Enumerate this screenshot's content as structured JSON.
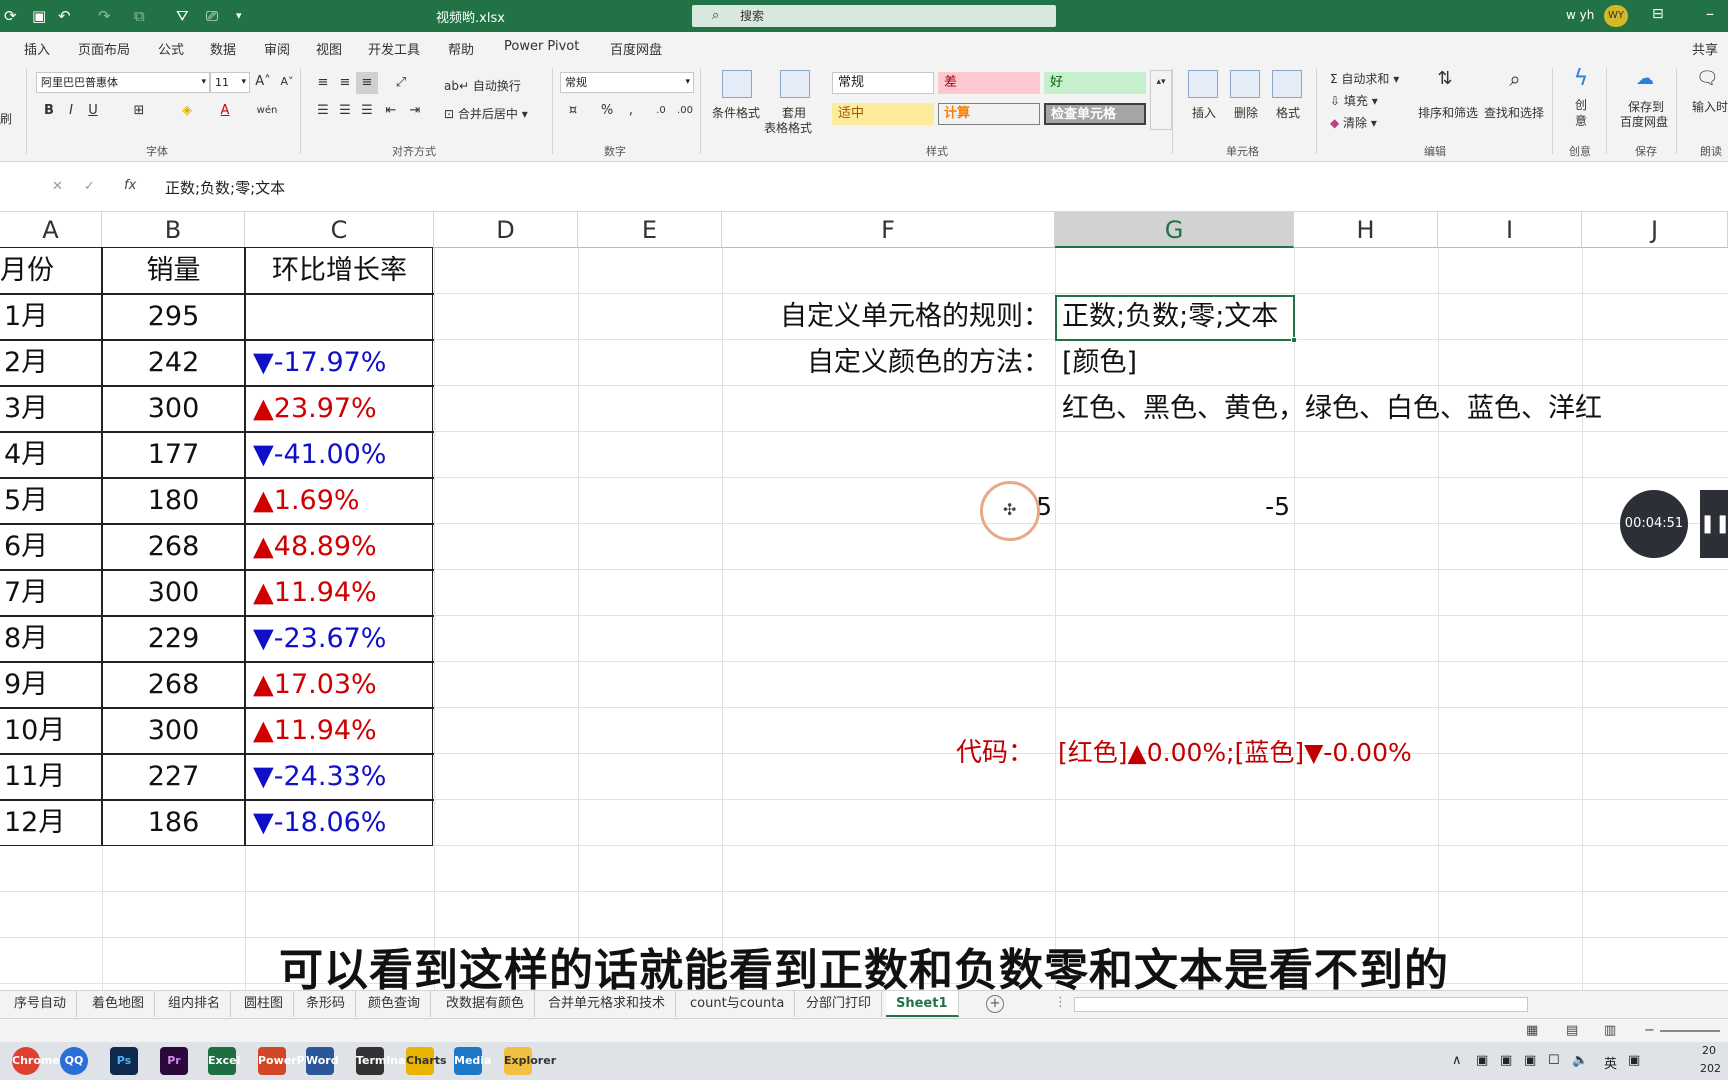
{
  "titlebar": {
    "filename": "视频哟.xlsx",
    "search_placeholder": "搜索",
    "user": "w yh",
    "avatar": "WY"
  },
  "menu": [
    "插入",
    "页面布局",
    "公式",
    "数据",
    "审阅",
    "视图",
    "开发工具",
    "帮助",
    "Power Pivot",
    "百度网盘"
  ],
  "share_label": "共享",
  "ribbon": {
    "font_name": "阿里巴巴普惠体",
    "font_size": "11",
    "wrap_text": "自动换行",
    "merge_center": "合并后居中",
    "number_format": "常规",
    "cond_format": "条件格式",
    "table_format_1": "套用",
    "table_format_2": "表格格式",
    "styles": {
      "normal": "常规",
      "bad": "差",
      "good": "好",
      "neutral": "适中",
      "calc": "计算",
      "check": "检查单元格"
    },
    "insert": "插入",
    "delete": "删除",
    "format": "格式",
    "autosum": "自动求和",
    "fill": "填充",
    "clear": "清除",
    "sort_filter": "排序和筛选",
    "find_select": "查找和选择",
    "creative_1": "创",
    "creative_2": "意",
    "save_baidu_1": "保存到",
    "save_baidu_2": "百度网盘",
    "input_label": "输入时",
    "groups": {
      "clipboard": "刷",
      "font": "字体",
      "alignment": "对齐方式",
      "number": "数字",
      "styles": "样式",
      "cells": "单元格",
      "editing": "编辑",
      "creative": "创意",
      "save": "保存",
      "read": "朗读"
    }
  },
  "formula_bar": {
    "value": "正数;负数;零;文本"
  },
  "columns": [
    "A",
    "B",
    "C",
    "D",
    "E",
    "F",
    "G",
    "H",
    "I",
    "J"
  ],
  "table": {
    "headers": [
      "月份",
      "销量",
      "环比增长率"
    ],
    "rows": [
      {
        "month": "1月",
        "sales": "295",
        "rate": "",
        "dir": ""
      },
      {
        "month": "2月",
        "sales": "242",
        "rate": "▼-17.97%",
        "dir": "down"
      },
      {
        "month": "3月",
        "sales": "300",
        "rate": "▲23.97%",
        "dir": "up"
      },
      {
        "month": "4月",
        "sales": "177",
        "rate": "▼-41.00%",
        "dir": "down"
      },
      {
        "month": "5月",
        "sales": "180",
        "rate": "▲1.69%",
        "dir": "up"
      },
      {
        "month": "6月",
        "sales": "268",
        "rate": "▲48.89%",
        "dir": "up"
      },
      {
        "month": "7月",
        "sales": "300",
        "rate": "▲11.94%",
        "dir": "up"
      },
      {
        "month": "8月",
        "sales": "229",
        "rate": "▼-23.67%",
        "dir": "down"
      },
      {
        "month": "9月",
        "sales": "268",
        "rate": "▲17.03%",
        "dir": "up"
      },
      {
        "month": "10月",
        "sales": "300",
        "rate": "▲11.94%",
        "dir": "up"
      },
      {
        "month": "11月",
        "sales": "227",
        "rate": "▼-24.33%",
        "dir": "down"
      },
      {
        "month": "12月",
        "sales": "186",
        "rate": "▼-18.06%",
        "dir": "down"
      }
    ]
  },
  "notes": {
    "rule_label": "自定义单元格的规则：",
    "rule_value": "正数;负数;零;文本",
    "color_label": "自定义颜色的方法：",
    "color_value": "[颜色]",
    "color_list": "红色、黑色、黄色，绿色、白色、蓝色、洋红",
    "f6_value": "5",
    "g6_value": "-5",
    "code_label": "代码：",
    "code_value": "[红色]▲0.00%;[蓝色]▼-0.00%"
  },
  "timer": "00:04:51",
  "subtitle": "可以看到这样的话就能看到正数和负数零和文本是看不到的",
  "sheet_tabs": [
    "序号自动",
    "着色地图",
    "组内排名",
    "圆柱图",
    "条形码",
    "颜色查询",
    "改数据有颜色",
    "合并单元格求和技术",
    "count与counta",
    "分部门打印",
    "Sheet1"
  ],
  "active_sheet": "Sheet1",
  "taskbar": {
    "apps": [
      "Chrome",
      "QQ",
      "Ps",
      "Pr",
      "Excel",
      "PowerPoint",
      "Word",
      "Terminal",
      "Charts",
      "Media",
      "Explorer"
    ],
    "ime": "英",
    "clock_1": "20",
    "clock_2": "202"
  },
  "colors": {
    "excel_green": "#217346",
    "up_red": "#d00000",
    "down_blue": "#1010c8",
    "code_red": "#c00000"
  }
}
